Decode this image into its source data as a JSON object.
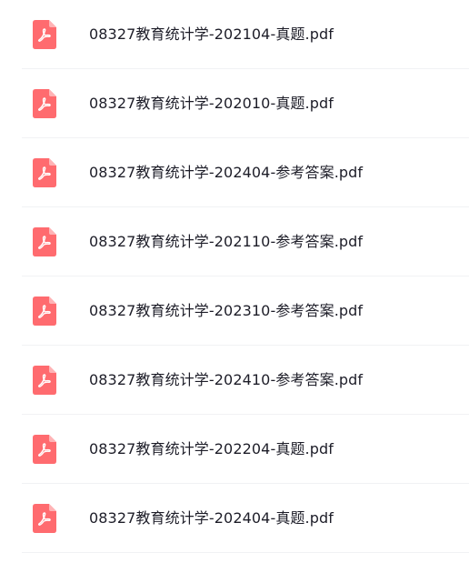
{
  "icon": {
    "name": "pdf-icon",
    "color": "#ff6b6f"
  },
  "files": [
    {
      "name": "08327教育统计学-202104-真题.pdf"
    },
    {
      "name": "08327教育统计学-202010-真题.pdf"
    },
    {
      "name": "08327教育统计学-202404-参考答案.pdf"
    },
    {
      "name": "08327教育统计学-202110-参考答案.pdf"
    },
    {
      "name": "08327教育统计学-202310-参考答案.pdf"
    },
    {
      "name": "08327教育统计学-202410-参考答案.pdf"
    },
    {
      "name": "08327教育统计学-202204-真题.pdf"
    },
    {
      "name": "08327教育统计学-202404-真题.pdf"
    }
  ]
}
